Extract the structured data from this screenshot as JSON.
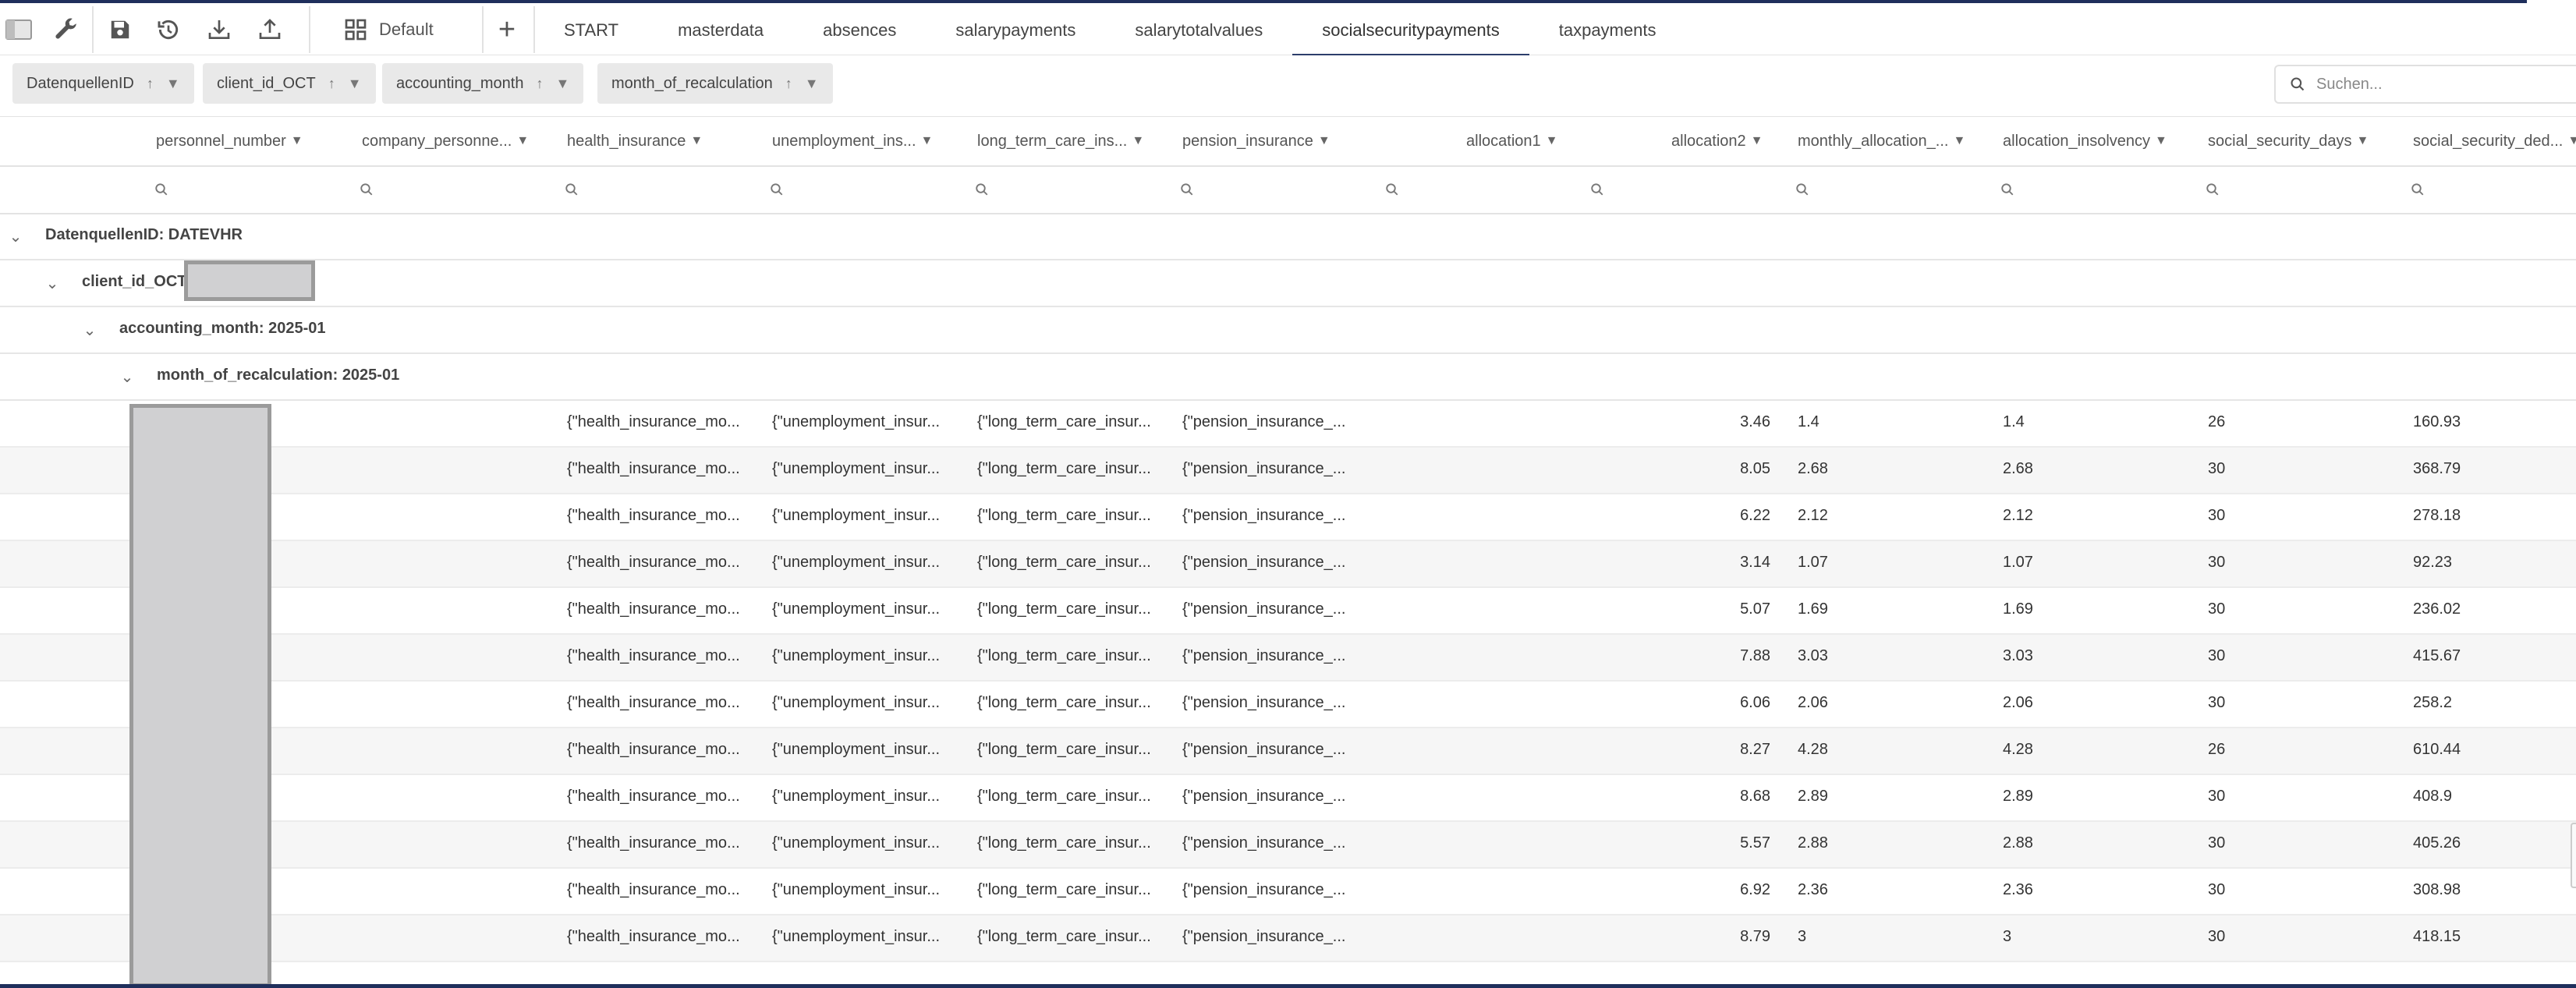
{
  "toolbar": {
    "icons": [
      "sidebar-toggle-icon",
      "wrench-icon",
      "save-icon",
      "history-icon",
      "download-icon",
      "upload-icon"
    ],
    "layout_label": "Default",
    "add_label": "+"
  },
  "tabs": [
    {
      "label": "START",
      "active": false
    },
    {
      "label": "masterdata",
      "active": false
    },
    {
      "label": "absences",
      "active": false
    },
    {
      "label": "salarypayments",
      "active": false
    },
    {
      "label": "salarytotalvalues",
      "active": false
    },
    {
      "label": "socialsecuritypayments",
      "active": true
    },
    {
      "label": "taxpayments",
      "active": false
    }
  ],
  "group_chips": [
    {
      "label": "DatenquellenID"
    },
    {
      "label": "client_id_OCT"
    },
    {
      "label": "accounting_month"
    },
    {
      "label": "month_of_recalculation"
    }
  ],
  "search": {
    "placeholder": "Suchen..."
  },
  "columns": [
    {
      "label": "personnel_number"
    },
    {
      "label": "company_personne..."
    },
    {
      "label": "health_insurance"
    },
    {
      "label": "unemployment_ins..."
    },
    {
      "label": "long_term_care_ins..."
    },
    {
      "label": "pension_insurance"
    },
    {
      "label": "allocation1"
    },
    {
      "label": "allocation2"
    },
    {
      "label": "monthly_allocation_..."
    },
    {
      "label": "allocation_insolvency"
    },
    {
      "label": "social_security_days"
    },
    {
      "label": "social_security_ded..."
    }
  ],
  "groups": [
    {
      "label": "DatenquellenID: DATEVHR"
    },
    {
      "label": "client_id_OCT:"
    },
    {
      "label": "accounting_month: 2025-01"
    },
    {
      "label": "month_of_recalculation: 2025-01"
    }
  ],
  "rows": [
    {
      "health": "{\"health_insurance_mo...",
      "unemp": "{\"unemployment_insur...",
      "ltc": "{\"long_term_care_insur...",
      "pension": "{\"pension_insurance_...",
      "allocation2": "3.46",
      "monthly": "1.4",
      "insolvency": "1.4",
      "days": "26",
      "ded": "160.93"
    },
    {
      "health": "{\"health_insurance_mo...",
      "unemp": "{\"unemployment_insur...",
      "ltc": "{\"long_term_care_insur...",
      "pension": "{\"pension_insurance_...",
      "allocation2": "8.05",
      "monthly": "2.68",
      "insolvency": "2.68",
      "days": "30",
      "ded": "368.79"
    },
    {
      "health": "{\"health_insurance_mo...",
      "unemp": "{\"unemployment_insur...",
      "ltc": "{\"long_term_care_insur...",
      "pension": "{\"pension_insurance_...",
      "allocation2": "6.22",
      "monthly": "2.12",
      "insolvency": "2.12",
      "days": "30",
      "ded": "278.18"
    },
    {
      "health": "{\"health_insurance_mo...",
      "unemp": "{\"unemployment_insur...",
      "ltc": "{\"long_term_care_insur...",
      "pension": "{\"pension_insurance_...",
      "allocation2": "3.14",
      "monthly": "1.07",
      "insolvency": "1.07",
      "days": "30",
      "ded": "92.23"
    },
    {
      "health": "{\"health_insurance_mo...",
      "unemp": "{\"unemployment_insur...",
      "ltc": "{\"long_term_care_insur...",
      "pension": "{\"pension_insurance_...",
      "allocation2": "5.07",
      "monthly": "1.69",
      "insolvency": "1.69",
      "days": "30",
      "ded": "236.02"
    },
    {
      "health": "{\"health_insurance_mo...",
      "unemp": "{\"unemployment_insur...",
      "ltc": "{\"long_term_care_insur...",
      "pension": "{\"pension_insurance_...",
      "allocation2": "7.88",
      "monthly": "3.03",
      "insolvency": "3.03",
      "days": "30",
      "ded": "415.67"
    },
    {
      "health": "{\"health_insurance_mo...",
      "unemp": "{\"unemployment_insur...",
      "ltc": "{\"long_term_care_insur...",
      "pension": "{\"pension_insurance_...",
      "allocation2": "6.06",
      "monthly": "2.06",
      "insolvency": "2.06",
      "days": "30",
      "ded": "258.2"
    },
    {
      "health": "{\"health_insurance_mo...",
      "unemp": "{\"unemployment_insur...",
      "ltc": "{\"long_term_care_insur...",
      "pension": "{\"pension_insurance_...",
      "allocation2": "8.27",
      "monthly": "4.28",
      "insolvency": "4.28",
      "days": "26",
      "ded": "610.44"
    },
    {
      "health": "{\"health_insurance_mo...",
      "unemp": "{\"unemployment_insur...",
      "ltc": "{\"long_term_care_insur...",
      "pension": "{\"pension_insurance_...",
      "allocation2": "8.68",
      "monthly": "2.89",
      "insolvency": "2.89",
      "days": "30",
      "ded": "408.9"
    },
    {
      "health": "{\"health_insurance_mo...",
      "unemp": "{\"unemployment_insur...",
      "ltc": "{\"long_term_care_insur...",
      "pension": "{\"pension_insurance_...",
      "allocation2": "5.57",
      "monthly": "2.88",
      "insolvency": "2.88",
      "days": "30",
      "ded": "405.26"
    },
    {
      "health": "{\"health_insurance_mo...",
      "unemp": "{\"unemployment_insur...",
      "ltc": "{\"long_term_care_insur...",
      "pension": "{\"pension_insurance_...",
      "allocation2": "6.92",
      "monthly": "2.36",
      "insolvency": "2.36",
      "days": "30",
      "ded": "308.98"
    },
    {
      "health": "{\"health_insurance_mo...",
      "unemp": "{\"unemployment_insur...",
      "ltc": "{\"long_term_care_insur...",
      "pension": "{\"pension_insurance_...",
      "allocation2": "8.79",
      "monthly": "3",
      "insolvency": "3",
      "days": "30",
      "ded": "418.15"
    }
  ]
}
